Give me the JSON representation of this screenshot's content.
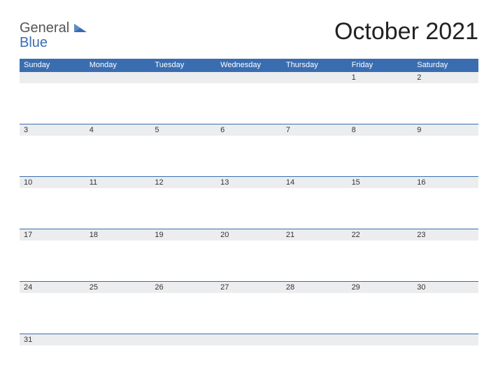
{
  "logo": {
    "text1": "General",
    "text2": "Blue"
  },
  "title": "October 2021",
  "days_of_week": [
    "Sunday",
    "Monday",
    "Tuesday",
    "Wednesday",
    "Thursday",
    "Friday",
    "Saturday"
  ],
  "weeks": [
    [
      "",
      "",
      "",
      "",
      "",
      "1",
      "2"
    ],
    [
      "3",
      "4",
      "5",
      "6",
      "7",
      "8",
      "9"
    ],
    [
      "10",
      "11",
      "12",
      "13",
      "14",
      "15",
      "16"
    ],
    [
      "17",
      "18",
      "19",
      "20",
      "21",
      "22",
      "23"
    ],
    [
      "24",
      "25",
      "26",
      "27",
      "28",
      "29",
      "30"
    ],
    [
      "31",
      "",
      "",
      "",
      "",
      "",
      ""
    ]
  ]
}
